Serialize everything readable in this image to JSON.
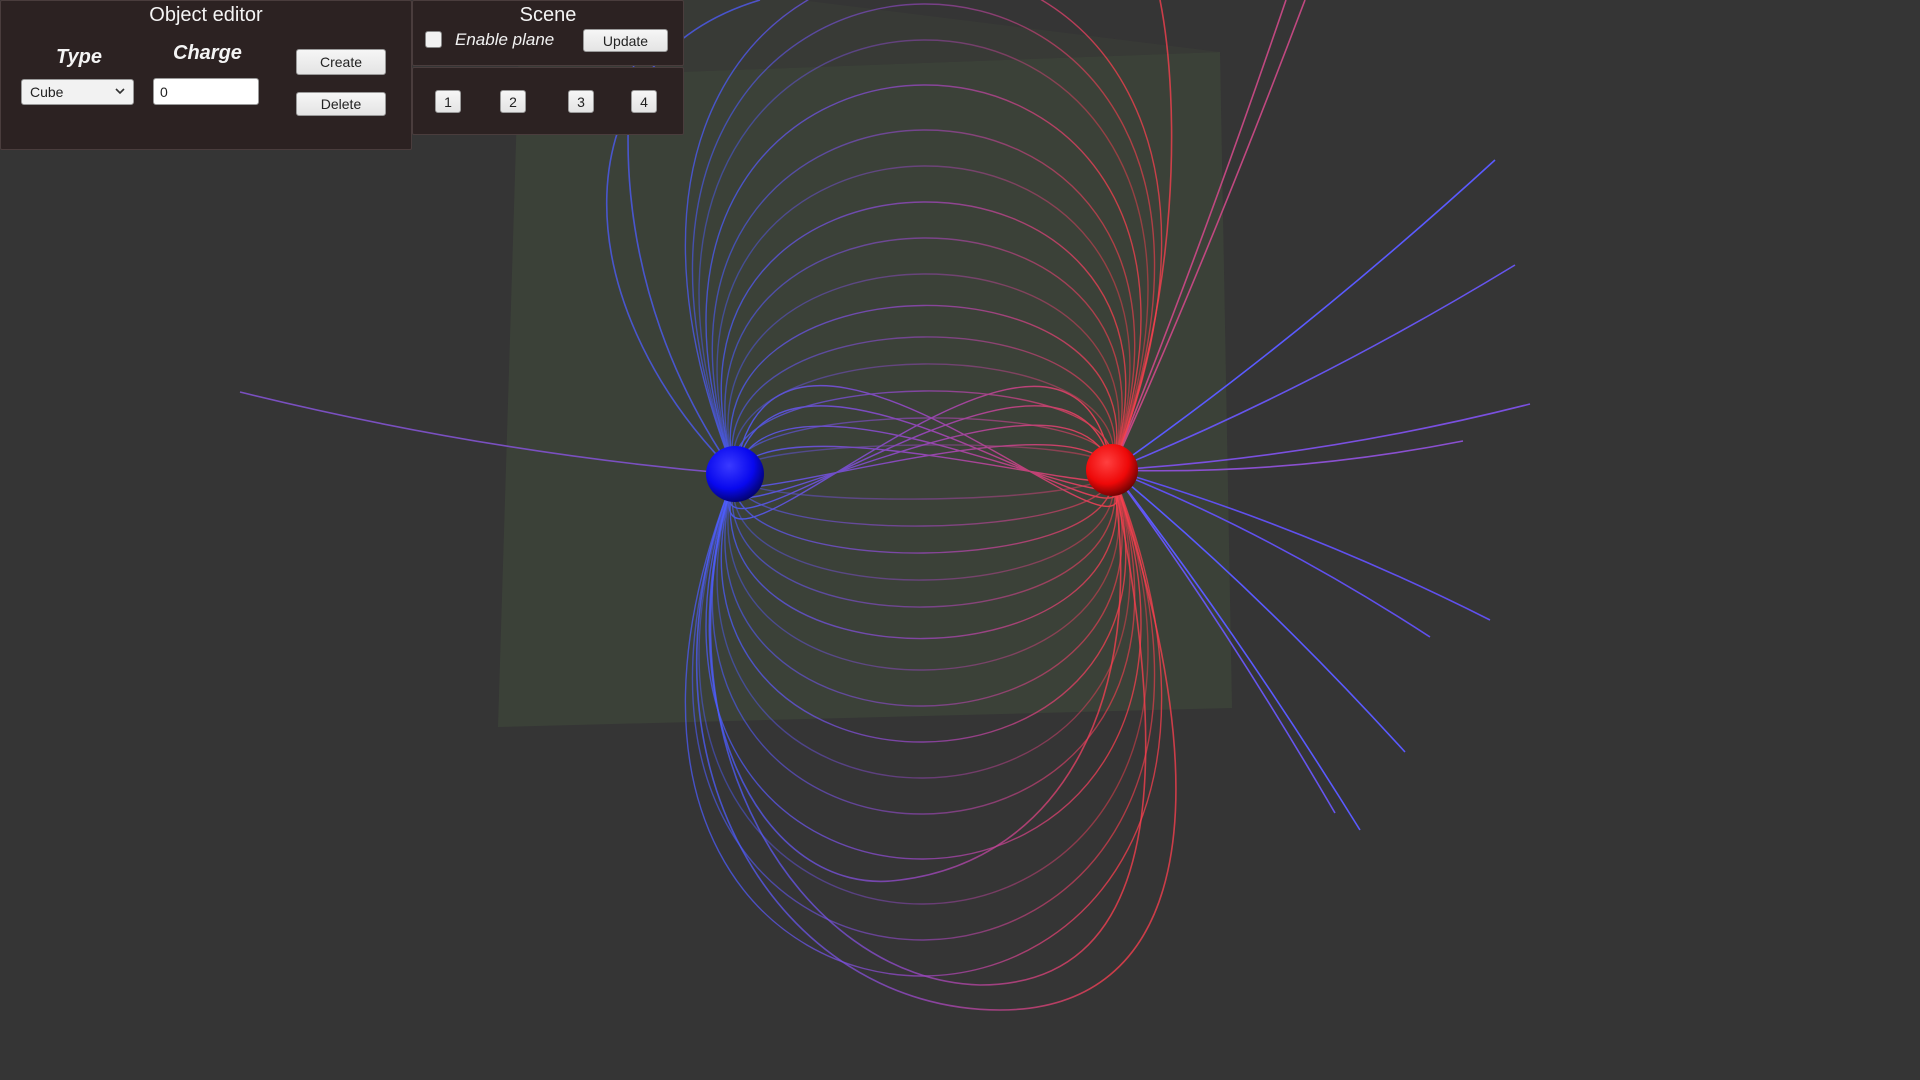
{
  "object_editor": {
    "title": "Object editor",
    "type_label": "Type",
    "charge_label": "Charge",
    "type_value": "Cube",
    "charge_value": "0",
    "create_label": "Create",
    "delete_label": "Delete"
  },
  "scene": {
    "title": "Scene",
    "enable_plane_label": "Enable plane",
    "enable_plane_checked": false,
    "update_label": "Update"
  },
  "presets": {
    "buttons": [
      "1",
      "2",
      "3",
      "4"
    ]
  },
  "viewport": {
    "charges": [
      {
        "name": "negative-charge",
        "color": "#1010ff"
      },
      {
        "name": "positive-charge",
        "color": "#ff1010"
      }
    ],
    "colors": {
      "background": "#353535",
      "plane": "#3c4238",
      "field_line_negative": "#4d5cff",
      "field_line_positive": "#ff3f4f",
      "field_line_mid": "#a048c8"
    },
    "icons": [
      "chevron-down-icon"
    ]
  }
}
